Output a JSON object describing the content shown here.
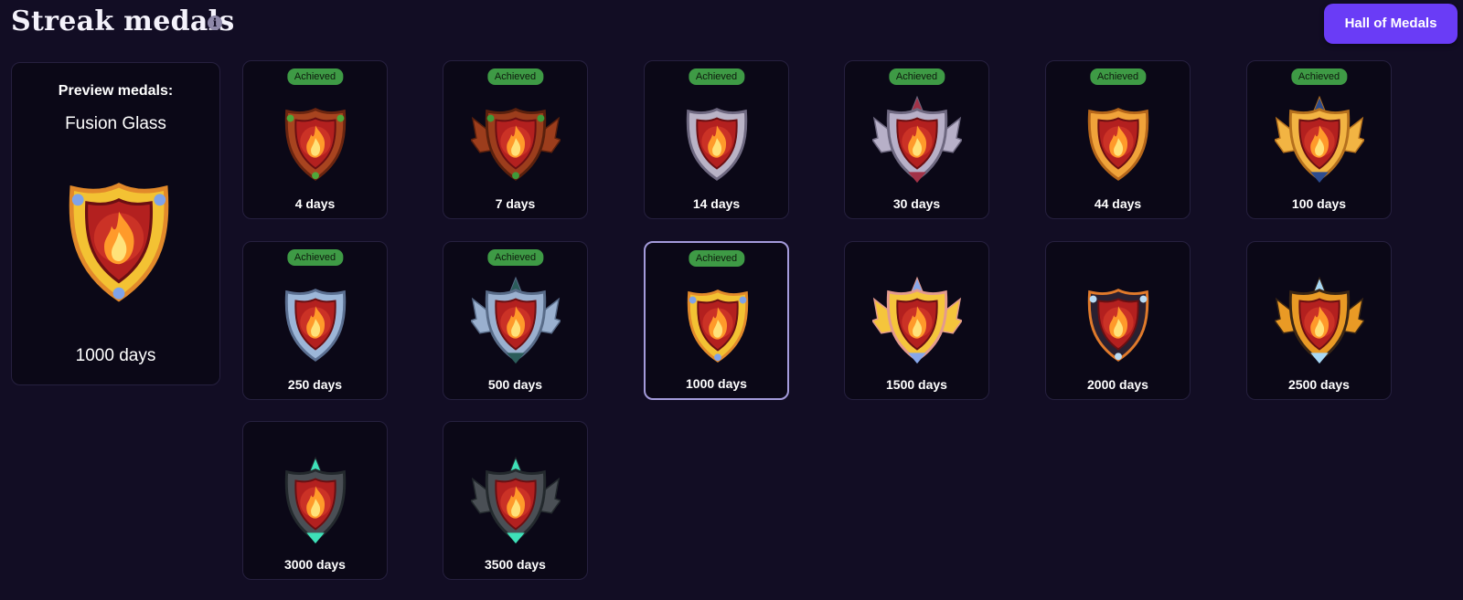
{
  "header": {
    "title": "Streak medals",
    "info_icon": "i",
    "hall_button": "Hall of Medals"
  },
  "preview": {
    "label": "Preview medals:",
    "name": "Fusion Glass",
    "days": "1000 days"
  },
  "badge_text": "Achieved",
  "medals": [
    {
      "days": "4 days",
      "achieved": true,
      "style": "wood"
    },
    {
      "days": "7 days",
      "achieved": true,
      "style": "vine"
    },
    {
      "days": "14 days",
      "achieved": true,
      "style": "silver"
    },
    {
      "days": "30 days",
      "achieved": true,
      "style": "silver-winged"
    },
    {
      "days": "44 days",
      "achieved": true,
      "style": "gold"
    },
    {
      "days": "100 days",
      "achieved": true,
      "style": "gold-winged"
    },
    {
      "days": "250 days",
      "achieved": true,
      "style": "steel"
    },
    {
      "days": "500 days",
      "achieved": true,
      "style": "steel-winged"
    },
    {
      "days": "1000 days",
      "achieved": true,
      "style": "fusion-glass",
      "selected": true
    },
    {
      "days": "1500 days",
      "achieved": false,
      "style": "fusion-winged"
    },
    {
      "days": "2000 days",
      "achieved": false,
      "style": "obsidian"
    },
    {
      "days": "2500 days",
      "achieved": false,
      "style": "ice-fire"
    },
    {
      "days": "3000 days",
      "achieved": false,
      "style": "emerald"
    },
    {
      "days": "3500 days",
      "achieved": false,
      "style": "emerald-winged"
    }
  ],
  "colors": {
    "accent": "#6a3cf6",
    "badge": "#3e9a45",
    "background": "#120d24",
    "card": "#0b0817",
    "selected_border": "#a49bdb"
  }
}
